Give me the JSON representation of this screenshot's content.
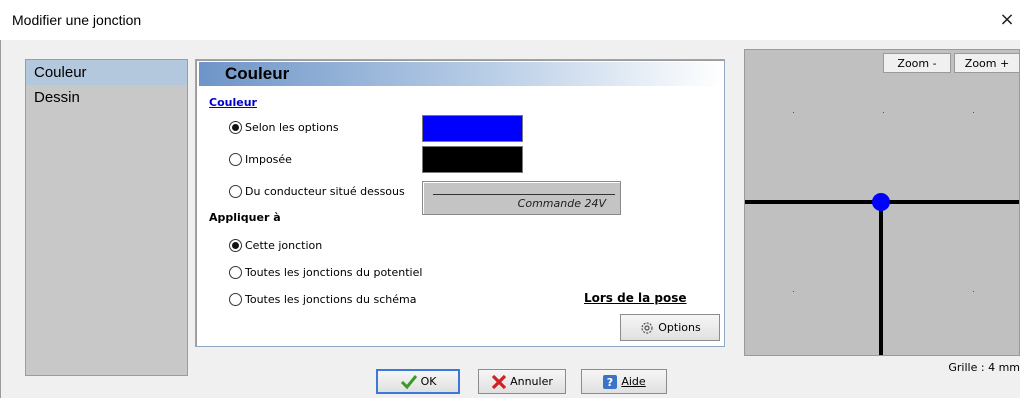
{
  "window": {
    "title": "Modifier une jonction",
    "close_glyph": "×"
  },
  "nav": {
    "items": [
      {
        "label": "Couleur",
        "selected": true
      },
      {
        "label": "Dessin",
        "selected": false
      }
    ]
  },
  "panel": {
    "header": "Couleur",
    "color_section": {
      "title": "Couleur",
      "options": [
        {
          "label": "Selon les options",
          "checked": true,
          "swatch": "#0000ff"
        },
        {
          "label": "Imposée",
          "checked": false,
          "swatch": "#000000"
        },
        {
          "label": "Du conducteur situé dessous",
          "checked": false
        }
      ],
      "conductor_caption": "Commande 24V"
    },
    "apply_section": {
      "title": "Appliquer à",
      "options": [
        {
          "label": "Cette jonction",
          "checked": true
        },
        {
          "label": "Toutes les jonctions du potentiel",
          "checked": false
        },
        {
          "label": "Toutes les jonctions du schéma",
          "checked": false
        }
      ]
    },
    "pose_link": "Lors de la pose",
    "options_button": "Options"
  },
  "preview": {
    "zoom_out_label": "Zoom -",
    "zoom_in_label": "Zoom +",
    "grid_label": "Grille : 4 mm",
    "junction_color": "#0000ff",
    "background": "#c0c0c0"
  },
  "footer": {
    "ok_label": "OK",
    "cancel_label": "Annuler",
    "help_label": "Aide"
  },
  "icons": {
    "ok": "checkmark-icon",
    "cancel": "cross-icon",
    "help": "help-icon",
    "options": "gear-icon",
    "close": "close-icon"
  }
}
